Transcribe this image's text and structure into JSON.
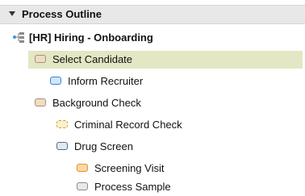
{
  "outline": {
    "title": "Process Outline",
    "root": {
      "label": "[HR] Hiring - Onboarding",
      "icon": "process-tree-icon"
    },
    "items": [
      {
        "label": "Select Candidate",
        "icon": "tan-shape-icon"
      },
      {
        "label": "Inform Recruiter",
        "icon": "blue-shape-icon"
      },
      {
        "label": "Background Check",
        "icon": "tan-shape-icon"
      },
      {
        "label": "Criminal Record Check",
        "icon": "cream-dashed-shape-icon"
      },
      {
        "label": "Drug Screen",
        "icon": "slate-shape-icon"
      },
      {
        "label": "Screening Visit",
        "icon": "orange-shape-icon"
      },
      {
        "label": "Process Sample",
        "icon": "gray-shape-icon"
      }
    ]
  },
  "colors": {
    "header_bg": "#e8e8e8",
    "selected_bg": "#e3e7c3",
    "tan": "#f0dcc2",
    "blue": "#cfe6fb",
    "cream": "#fbf0c7",
    "slate": "#e2e8f0",
    "orange": "#fbd9a5",
    "gray": "#e6e8ea"
  }
}
